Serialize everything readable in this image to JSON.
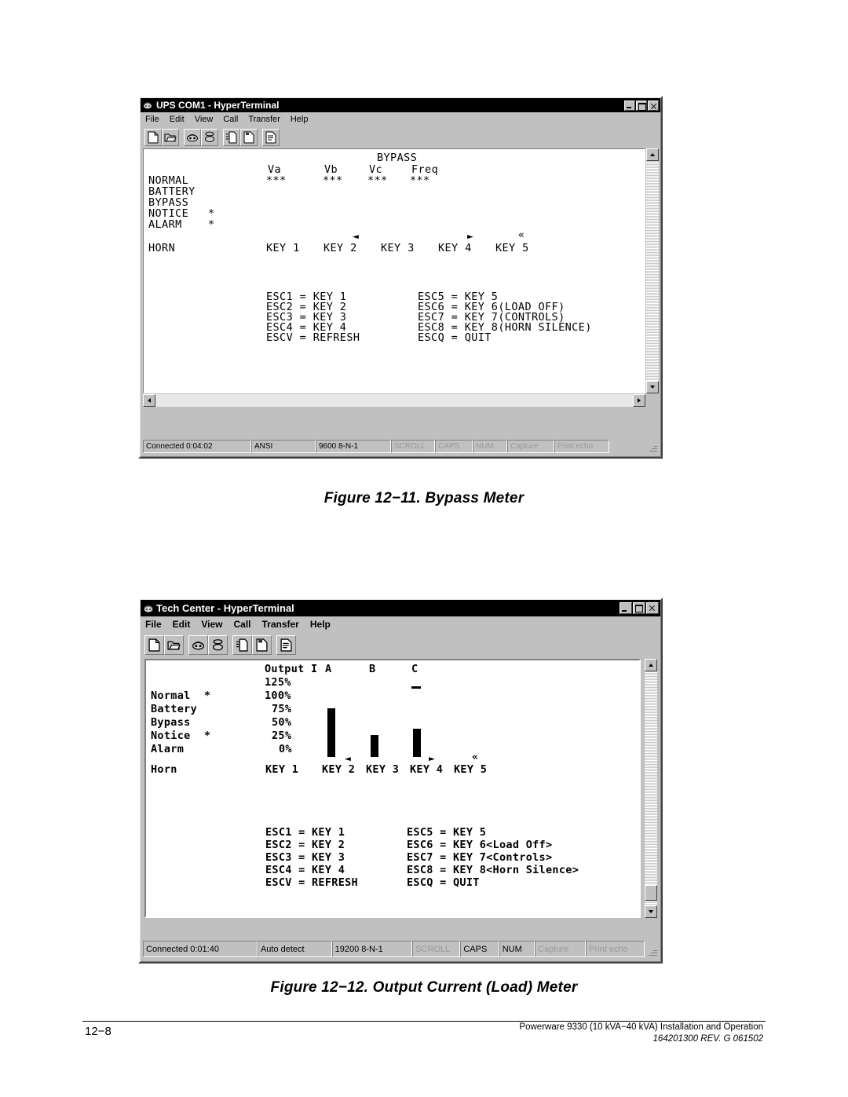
{
  "window1": {
    "title": "UPS COM1 - HyperTerminal",
    "icon": "hyperterminal-icon",
    "menu": [
      "File",
      "Edit",
      "View",
      "Call",
      "Transfer",
      "Help"
    ],
    "toolbar_buttons": [
      "new-connection",
      "open",
      "call",
      "disconnect",
      "send-file",
      "receive-file",
      "properties"
    ],
    "title_buttons": [
      "minimize",
      "maximize",
      "close"
    ],
    "terminal": {
      "screen_title": "BYPASS",
      "column_headers": [
        "Va",
        "Vb",
        "Vc",
        "Freq"
      ],
      "column_values": [
        "***",
        "***",
        "***",
        "***"
      ],
      "status_labels": [
        "NORMAL",
        "BATTERY",
        "BYPASS",
        "NOTICE",
        "ALARM"
      ],
      "status_flags": [
        "",
        "",
        "",
        "*",
        "*"
      ],
      "horn_label": "HORN",
      "keys": [
        "KEY 1",
        "KEY 2",
        "KEY 3",
        "KEY 4",
        "KEY 5"
      ],
      "key_markers": [
        "",
        "◄",
        "",
        "►",
        "«"
      ],
      "esc_left": [
        "ESC1 = KEY 1",
        "ESC2 = KEY 2",
        "ESC3 = KEY 3",
        "ESC4 = KEY 4",
        "ESCV = REFRESH"
      ],
      "esc_right": [
        "ESC5 = KEY 5",
        "ESC6 = KEY 6(LOAD OFF)",
        "ESC7 = KEY 7(CONTROLS)",
        "ESC8 = KEY 8(HORN SILENCE)",
        "ESCQ = QUIT"
      ]
    },
    "status": {
      "connected": "Connected 0:04:02",
      "emulation": "ANSI",
      "settings": "9600 8-N-1",
      "indicators": [
        {
          "label": "SCROLL",
          "active": false
        },
        {
          "label": "CAPS",
          "active": false
        },
        {
          "label": "NUM",
          "active": false
        },
        {
          "label": "Capture",
          "active": false
        },
        {
          "label": "Print echo",
          "active": false
        }
      ]
    }
  },
  "caption1": "Figure 12−11. Bypass Meter",
  "window2": {
    "title": "Tech Center - HyperTerminal",
    "icon": "hyperterminal-icon",
    "menu": [
      "File",
      "Edit",
      "View",
      "Call",
      "Transfer",
      "Help"
    ],
    "toolbar_buttons": [
      "new-connection",
      "open",
      "call",
      "disconnect",
      "send-file",
      "receive-file",
      "properties"
    ],
    "title_buttons": [
      "minimize",
      "maximize",
      "close"
    ],
    "terminal": {
      "screen_title": "Output I",
      "column_headers": [
        "A",
        "B",
        "C"
      ],
      "scale_labels": [
        "125%",
        "100%",
        "75%",
        "50%",
        "25%",
        "0%"
      ],
      "status_labels": [
        "Normal",
        "Battery",
        "Bypass",
        "Notice",
        "Alarm"
      ],
      "status_flags": [
        "*",
        "",
        "",
        "*",
        ""
      ],
      "horn_label": "Horn",
      "keys": [
        "KEY 1",
        "KEY 2",
        "KEY 3",
        "KEY 4",
        "KEY 5"
      ],
      "key_markers": [
        "",
        "◄",
        "",
        "►",
        "«"
      ],
      "esc_left": [
        "ESC1 = KEY 1",
        "ESC2 = KEY 2",
        "ESC3 = KEY 3",
        "ESC4 = KEY 4",
        "ESCV = REFRESH"
      ],
      "esc_right": [
        "ESC5 = KEY 5",
        "ESC6 = KEY 6<Load Off>",
        "ESC7 = KEY 7<Controls>",
        "ESC8 = KEY 8<Horn Silence>",
        "ESCQ = QUIT"
      ]
    },
    "status": {
      "connected": "Connected 0:01:40",
      "emulation": "Auto detect",
      "settings": "19200 8-N-1",
      "indicators": [
        {
          "label": "SCROLL",
          "active": false
        },
        {
          "label": "CAPS",
          "active": true
        },
        {
          "label": "NUM",
          "active": true
        },
        {
          "label": "Capture",
          "active": false
        },
        {
          "label": "Print echo",
          "active": false
        }
      ]
    }
  },
  "caption2": "Figure 12−12. Output Current (Load) Meter",
  "footer": {
    "page_number": "12−8",
    "line1": "Powerware 9330 (10 kVA−40 kVA) Installation and Operation",
    "line2": "164201300 REV. G  061502"
  },
  "chart_data": {
    "type": "bar",
    "title": "Output I",
    "categories": [
      "A",
      "B",
      "C"
    ],
    "values": [
      75,
      25,
      37
    ],
    "overload_marker": {
      "category": "C",
      "value": 112,
      "glyph": "−"
    },
    "ylabel": "",
    "xlabel": "",
    "ylim": [
      0,
      125
    ],
    "ytick_labels": [
      "125%",
      "100%",
      "75%",
      "50%",
      "25%",
      "0%"
    ],
    "ytick_values": [
      125,
      100,
      75,
      50,
      25,
      0
    ],
    "grid": false,
    "legend": "none"
  }
}
